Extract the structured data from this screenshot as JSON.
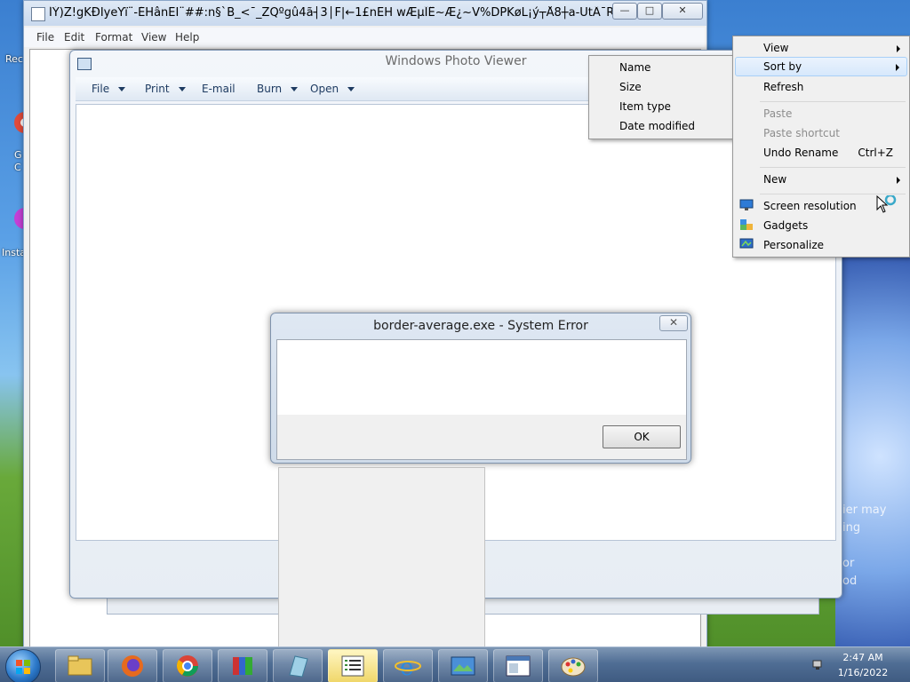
{
  "notepad": {
    "title": "ÍÝ)Z!gKÐIyeYï¨-ÉHânËÏ¨##:n§`B_<¯_ZQºgû4ã┤3│F|←1£nEH wÆµÎÊ~Æ¿~V%DPKøL¡ý┬Å8┼a-ÛtÂ¯R¨...",
    "menu": [
      "File",
      "Edit",
      "Format",
      "View",
      "Help"
    ],
    "min_label": "—",
    "max_label": "□",
    "close_label": "✕"
  },
  "photo_viewer": {
    "title": "Windows Photo Viewer",
    "toolbar": [
      {
        "label": "File",
        "has_arrow": true
      },
      {
        "label": "Print",
        "has_arrow": true
      },
      {
        "label": "E-mail",
        "has_arrow": false
      },
      {
        "label": "Burn",
        "has_arrow": true
      },
      {
        "label": "Open",
        "has_arrow": true
      }
    ]
  },
  "error_dialog": {
    "title": "border-average.exe - System Error",
    "close_label": "✕",
    "ok_label": "OK"
  },
  "context_menu": {
    "items": [
      {
        "label": "View",
        "submenu": true,
        "disabled": false,
        "icon": ""
      },
      {
        "label": "Sort by",
        "submenu": true,
        "disabled": false,
        "icon": "",
        "highlighted": true
      },
      {
        "label": "Refresh",
        "submenu": false,
        "disabled": false,
        "icon": ""
      },
      {
        "label": "Paste",
        "submenu": false,
        "disabled": true,
        "icon": ""
      },
      {
        "label": "Paste shortcut",
        "submenu": false,
        "disabled": true,
        "icon": ""
      },
      {
        "label": "Undo Rename",
        "shortcut": "Ctrl+Z",
        "submenu": false,
        "disabled": false,
        "icon": ""
      },
      {
        "label": "New",
        "submenu": true,
        "disabled": false,
        "icon": ""
      },
      {
        "label": "Screen resolution",
        "submenu": false,
        "disabled": false,
        "icon": "monitor-icon"
      },
      {
        "label": "Gadgets",
        "submenu": false,
        "disabled": false,
        "icon": "gadgets-icon"
      },
      {
        "label": "Personalize",
        "submenu": false,
        "disabled": false,
        "icon": "personalize-icon"
      }
    ]
  },
  "sort_submenu": {
    "items": [
      "Name",
      "Size",
      "Item type",
      "Date modified"
    ]
  },
  "desktop": {
    "icon_labels": [
      "Rec",
      "G",
      "C",
      "Insta"
    ],
    "wallpaper_text": [
      "ier may",
      "ing",
      "or",
      "od"
    ]
  },
  "taskbar": {
    "time": "2:47 AM",
    "date": "1/16/2022",
    "buttons": [
      {
        "name": "explorer",
        "icon": "folder-icon"
      },
      {
        "name": "firefox",
        "icon": "firefox-icon"
      },
      {
        "name": "chrome",
        "icon": "chrome-icon"
      },
      {
        "name": "winrar",
        "icon": "archive-icon"
      },
      {
        "name": "notebook",
        "icon": "notebook-icon"
      },
      {
        "name": "notepad",
        "icon": "list-icon",
        "active": true
      },
      {
        "name": "internet-explorer",
        "icon": "ie-icon"
      },
      {
        "name": "photo-viewer",
        "icon": "photo-icon"
      },
      {
        "name": "window",
        "icon": "window-icon"
      },
      {
        "name": "paint",
        "icon": "paint-icon"
      }
    ]
  },
  "colors": {
    "taskbar": "#4f6d94",
    "menu_highlight": "#d7e8fc",
    "dialog_frame": "#cfdbe9"
  }
}
